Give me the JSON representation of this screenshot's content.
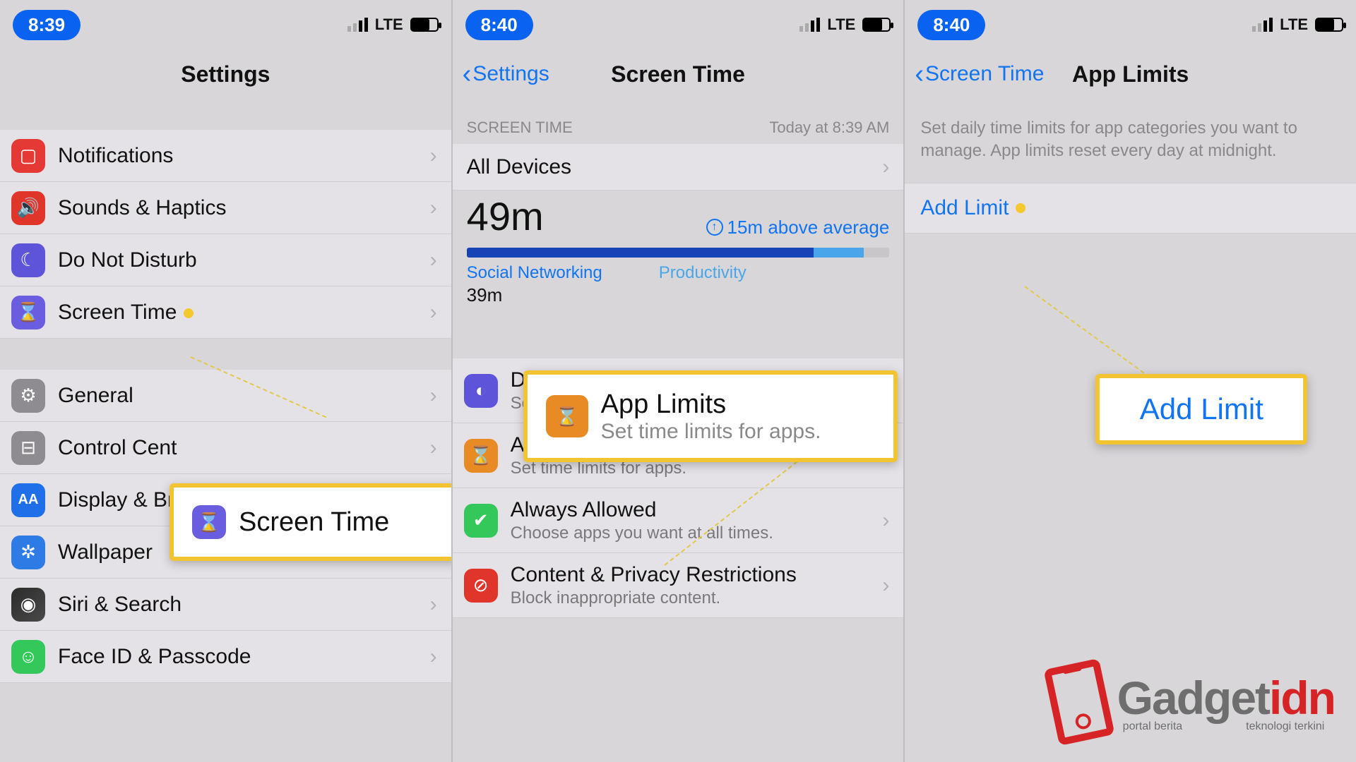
{
  "status": {
    "lte": "LTE"
  },
  "panel1": {
    "time": "8:39",
    "title": "Settings",
    "rows_a": [
      {
        "label": "Notifications",
        "icon": "notifications",
        "color": "c-red"
      },
      {
        "label": "Sounds & Haptics",
        "icon": "volume",
        "color": "c-vol"
      },
      {
        "label": "Do Not Disturb",
        "icon": "moon",
        "color": "c-moon"
      },
      {
        "label": "Screen Time",
        "icon": "hourglass",
        "color": "c-hour",
        "dot": true
      }
    ],
    "rows_b": [
      {
        "label": "General",
        "icon": "gear",
        "color": "c-gear"
      },
      {
        "label": "Control Cent",
        "icon": "switches",
        "color": "c-grey"
      },
      {
        "label": "Display & Br",
        "icon": "aa",
        "color": "c-blue"
      },
      {
        "label": "Wallpaper",
        "icon": "atom",
        "color": "c-atom"
      },
      {
        "label": "Siri & Search",
        "icon": "siri",
        "color": "c-siri"
      },
      {
        "label": "Face ID & Passcode",
        "icon": "face",
        "color": "c-face"
      }
    ],
    "callout": {
      "label": "Screen Time"
    }
  },
  "panel2": {
    "time": "8:40",
    "back": "Settings",
    "title": "Screen Time",
    "section_label": "SCREEN TIME",
    "timestamp": "Today at 8:39 AM",
    "all_devices": "All Devices",
    "total": "49m",
    "above_avg": "15m above average",
    "cat1": "Social Networking",
    "cat2": "Productivity",
    "cat1_val": "39m",
    "rows": [
      {
        "label": "Downtime",
        "sub": "Schedule time away from the screen.",
        "color": "c-down",
        "icon": "clock"
      },
      {
        "label": "App Limits",
        "sub": "Set time limits for apps.",
        "color": "c-applim",
        "icon": "hourglass",
        "dot": true
      },
      {
        "label": "Always Allowed",
        "sub": "Choose apps you want at all times.",
        "color": "c-allow",
        "icon": "check"
      },
      {
        "label": "Content & Privacy Restrictions",
        "sub": "Block inappropriate content.",
        "color": "c-priv",
        "icon": "block"
      }
    ],
    "callout": {
      "title": "App Limits",
      "sub": "Set time limits for apps."
    }
  },
  "panel3": {
    "time": "8:40",
    "back": "Screen Time",
    "title": "App Limits",
    "desc": "Set daily time limits for app categories you want to manage. App limits reset every day at midnight.",
    "add": "Add Limit",
    "callout": "Add Limit"
  },
  "watermark": {
    "grey": "Gadget",
    "red": "idn",
    "sub1": "portal berita",
    "sub2": "teknologi terkini"
  }
}
